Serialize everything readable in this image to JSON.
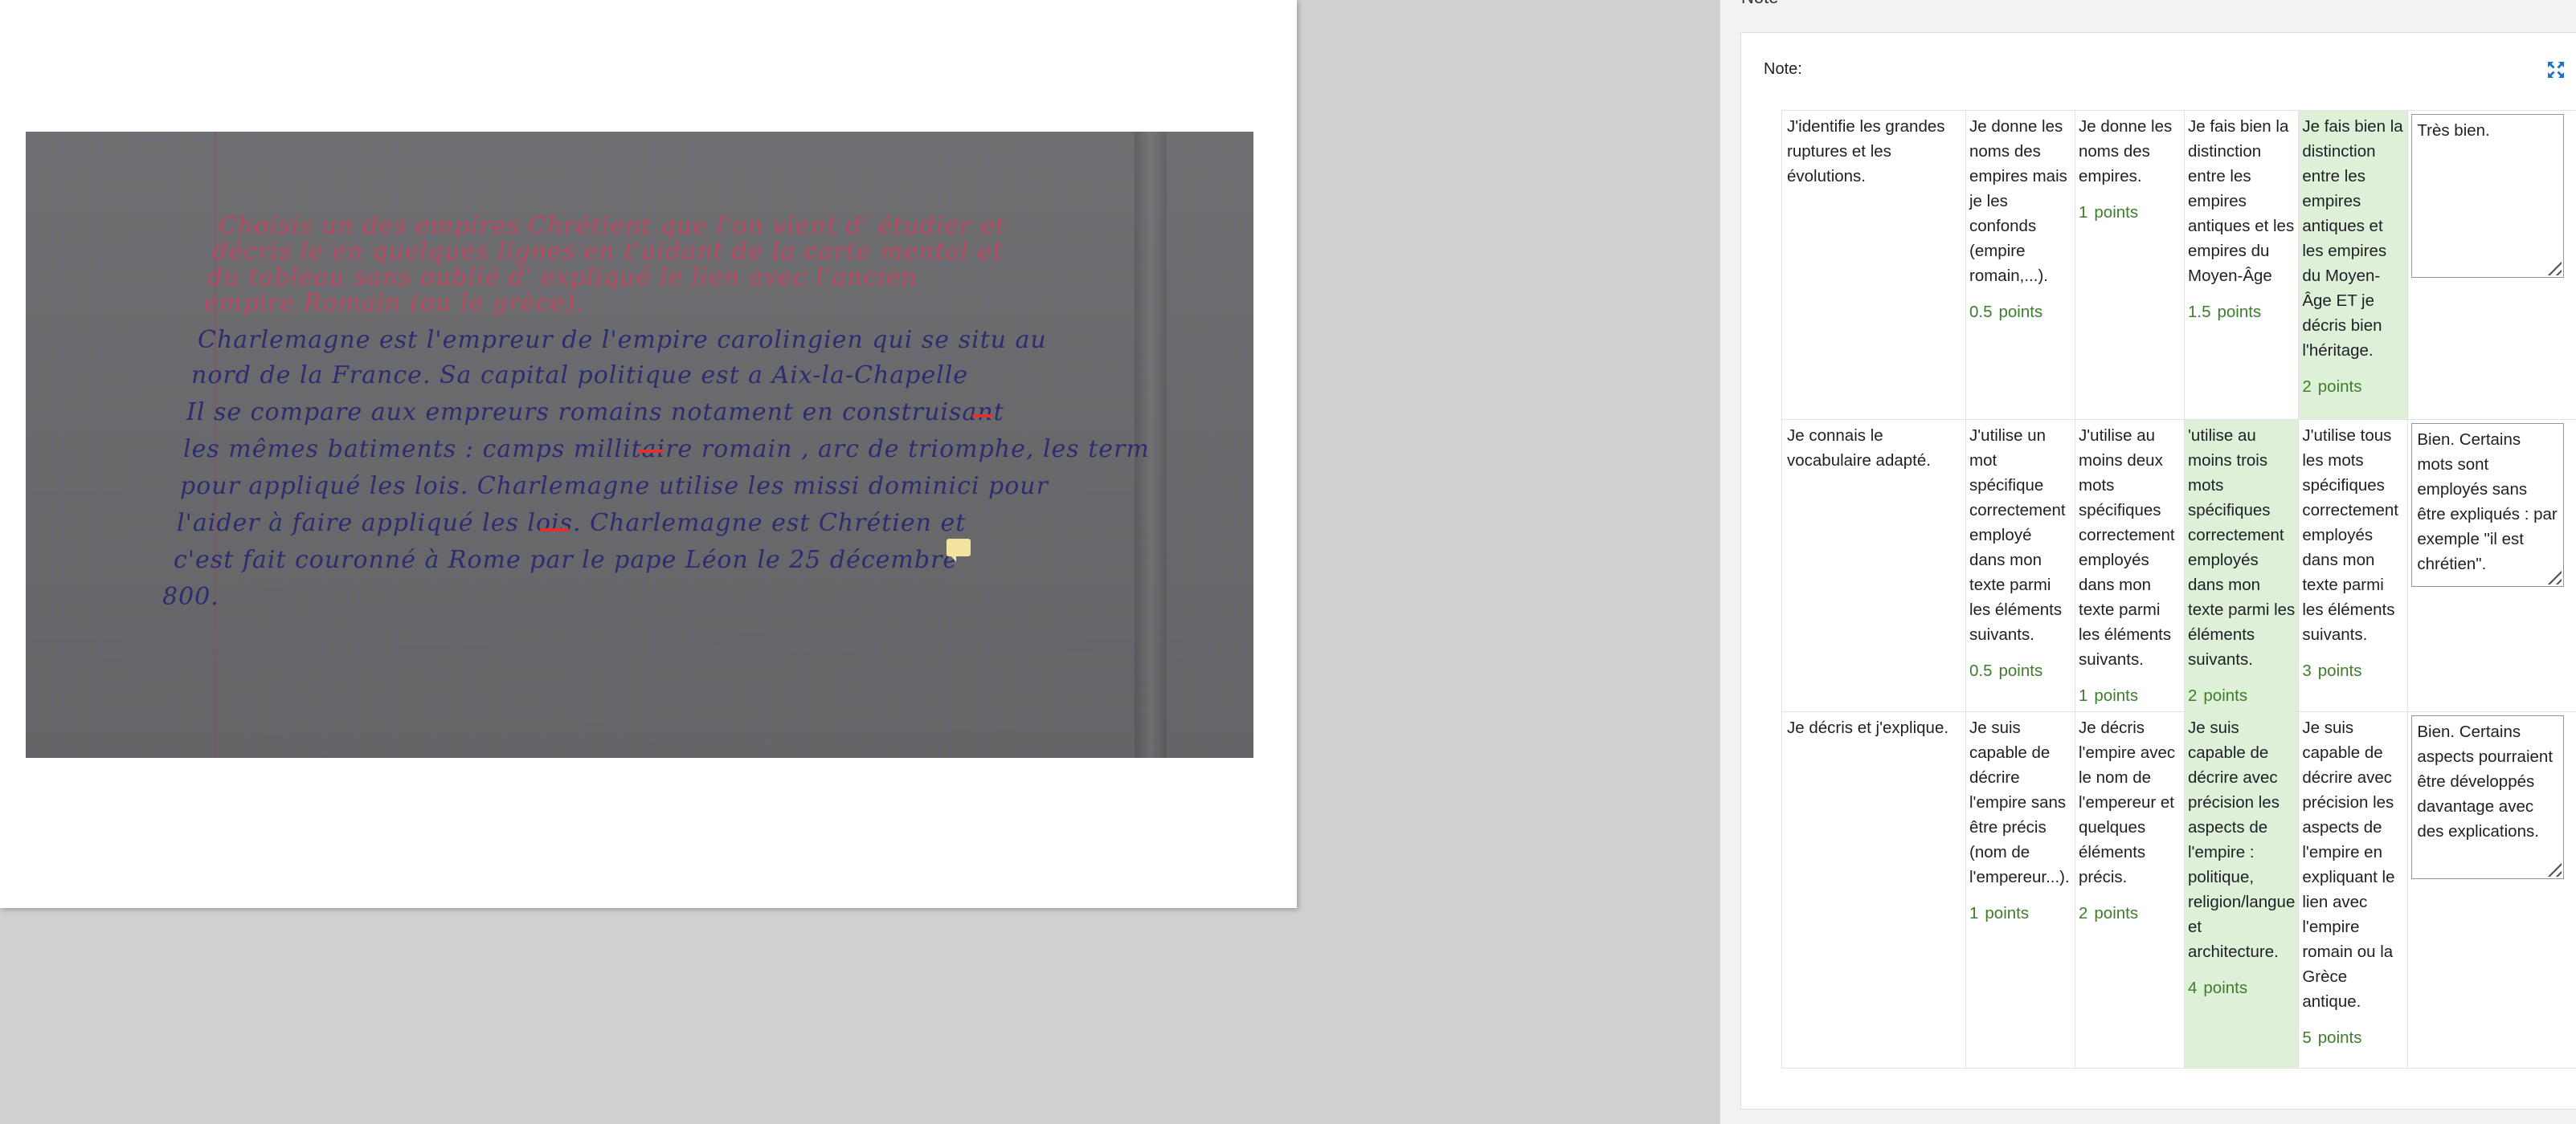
{
  "panel": {
    "heading": "Note",
    "note_label": "Note:"
  },
  "document": {
    "handwriting": {
      "prompt_lines": [
        "Choisis un des empires Chrétient que l'on vient d' étudier et",
        "décris le en quelques lignes en t'aidant de la carte mental et",
        "du tableau sans oublié d' expliqué le lien avec l'ancien",
        "empire Romain (ou le grèce)."
      ],
      "answer_lines": [
        "Charlemagne est l'empreur de l'empire carolingien qui se situ au",
        "nord de la France. Sa capital politique est a Aix-la-Chapelle",
        "Il se compare aux empreurs romains notament en construisant",
        "les mêmes batiments : camps millitaire romain , arc de triomphe, les term",
        "pour appliqué les lois. Charlemagne utilise les missi dominici pour",
        "l'aider à faire appliqué les lois. Charlemagne est Chrétien et",
        "c'est fait couronné à Rome par le pape Léon le 25 décembre",
        "800."
      ]
    }
  },
  "rubric": {
    "rows": [
      {
        "criterion": "J'identifie les grandes ruptures et les évolutions.",
        "levels": [
          {
            "text": "Je donne les noms des empires mais je les confonds (empire romain,...).",
            "points": "0.5",
            "selected": false
          },
          {
            "text": "Je donne les noms des empires.",
            "points": "1",
            "selected": false
          },
          {
            "text": "Je fais bien la distinction entre les empires antiques et les empires du Moyen-Âge",
            "points": "1.5",
            "selected": false
          },
          {
            "text": "Je fais bien la distinction entre les empires antiques et les empires du Moyen-Âge ET je décris bien l'héritage.",
            "points": "2",
            "selected": true
          }
        ],
        "remark": "Très bien."
      },
      {
        "criterion": "Je connais le vocabulaire adapté.",
        "levels": [
          {
            "text": "J'utilise un mot spécifique correctement employé dans mon texte parmi les éléments suivants.",
            "points": "0.5",
            "selected": false
          },
          {
            "text": "J'utilise au moins deux mots spécifiques correctement employés dans mon texte parmi les éléments suivants.",
            "points": "1",
            "selected": false
          },
          {
            "text": "'utilise au moins trois mots spécifiques correctement employés dans mon texte parmi les éléments suivants.",
            "points": "2",
            "selected": true
          },
          {
            "text": "J'utilise tous les mots spécifiques correctement employés dans mon texte parmi les éléments suivants.",
            "points": "3",
            "selected": false
          }
        ],
        "remark": "Bien. Certains mots sont employés sans être expliqués : par exemple \"il est chrétien\"."
      },
      {
        "criterion": "Je décris et j'explique.",
        "levels": [
          {
            "text": "Je suis capable de décrire l'empire sans être précis (nom de l'empereur...).",
            "points": "1",
            "selected": false
          },
          {
            "text": "Je décris l'empire avec le nom de l'empereur et quelques éléments précis.",
            "points": "2",
            "selected": false
          },
          {
            "text": "Je suis capable de décrire avec précision les aspects de l'empire : politique, religion/langue et architecture.",
            "points": "4",
            "selected": true
          },
          {
            "text": "Je suis capable de décrire avec précision les aspects de l'empire en expliquant le lien avec l'empire romain ou la Grèce antique.",
            "points": "5",
            "selected": false
          }
        ],
        "remark": "Bien. Certains aspects pourraient être développés davantage avec des explications."
      }
    ],
    "points_label": "points"
  },
  "colors": {
    "selected_level": "#dff0d8",
    "points_text": "#3e7d2c",
    "annotation": "#e23030",
    "comment": "#f3e3a0"
  },
  "icons": {
    "expand": "expand-arrows-icon",
    "comment": "comment-icon",
    "resize": "resize-grip-icon"
  }
}
